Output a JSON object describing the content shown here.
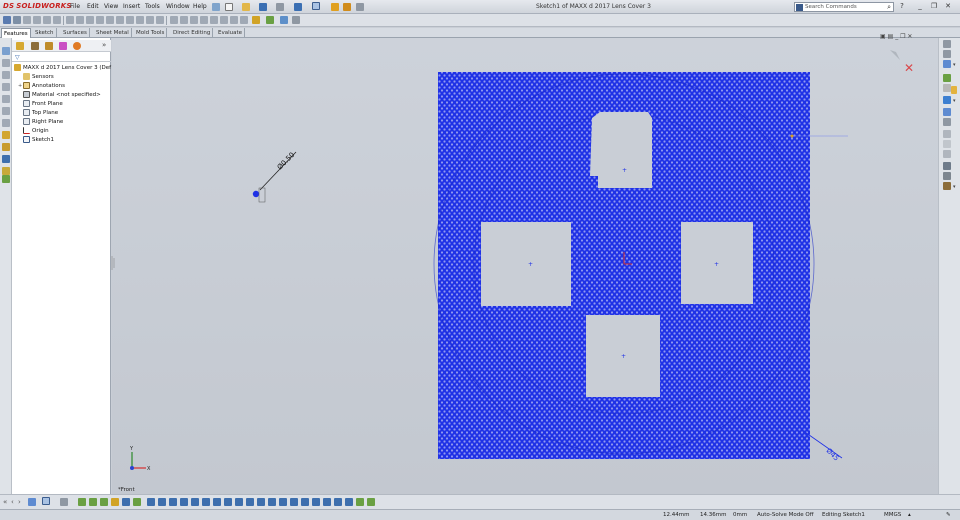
{
  "app": {
    "logo_text": "SOLIDWORKS",
    "logo_mark": "DS"
  },
  "menu": [
    "File",
    "Edit",
    "View",
    "Insert",
    "Tools",
    "Window",
    "Help"
  ],
  "window_title": "Sketch1 of MAXX d 2017 Lens Cover 3",
  "search": {
    "placeholder": "Search Commands"
  },
  "window_controls": [
    "?",
    "_",
    "❐",
    "✕"
  ],
  "command_tabs": [
    "Features",
    "Sketch",
    "Surfaces",
    "Sheet Metal",
    "Mold Tools",
    "Direct Editing",
    "Evaluate"
  ],
  "active_tab": "Features",
  "feature_tree": {
    "root": "MAXX d 2017 Lens Cover 3  (Def",
    "items": [
      {
        "label": "Sensors",
        "icon": "sensors-icon"
      },
      {
        "label": "Annotations",
        "icon": "annotations-icon"
      },
      {
        "label": "Material <not specified>",
        "icon": "material-icon"
      },
      {
        "label": "Front Plane",
        "icon": "plane-icon"
      },
      {
        "label": "Top Plane",
        "icon": "plane-icon"
      },
      {
        "label": "Right Plane",
        "icon": "plane-icon"
      },
      {
        "label": "Origin",
        "icon": "origin-icon"
      },
      {
        "label": "Sketch1",
        "icon": "sketch-icon"
      }
    ]
  },
  "graphics": {
    "view_name": "*Front",
    "dimension_small": "Ø0.50",
    "dimension_large": "Ø45",
    "pattern_color": "#1f31e6",
    "background_color": "#c9ced6"
  },
  "status": {
    "x": "12.44mm",
    "y": "14.36mm",
    "z": "0mm",
    "solve_mode": "Auto-Solve Mode Off",
    "editing": "Editing Sketch1",
    "units": "MMGS"
  },
  "colors": {
    "brand": "#c8201e",
    "sketch_blue": "#1f31e6"
  }
}
